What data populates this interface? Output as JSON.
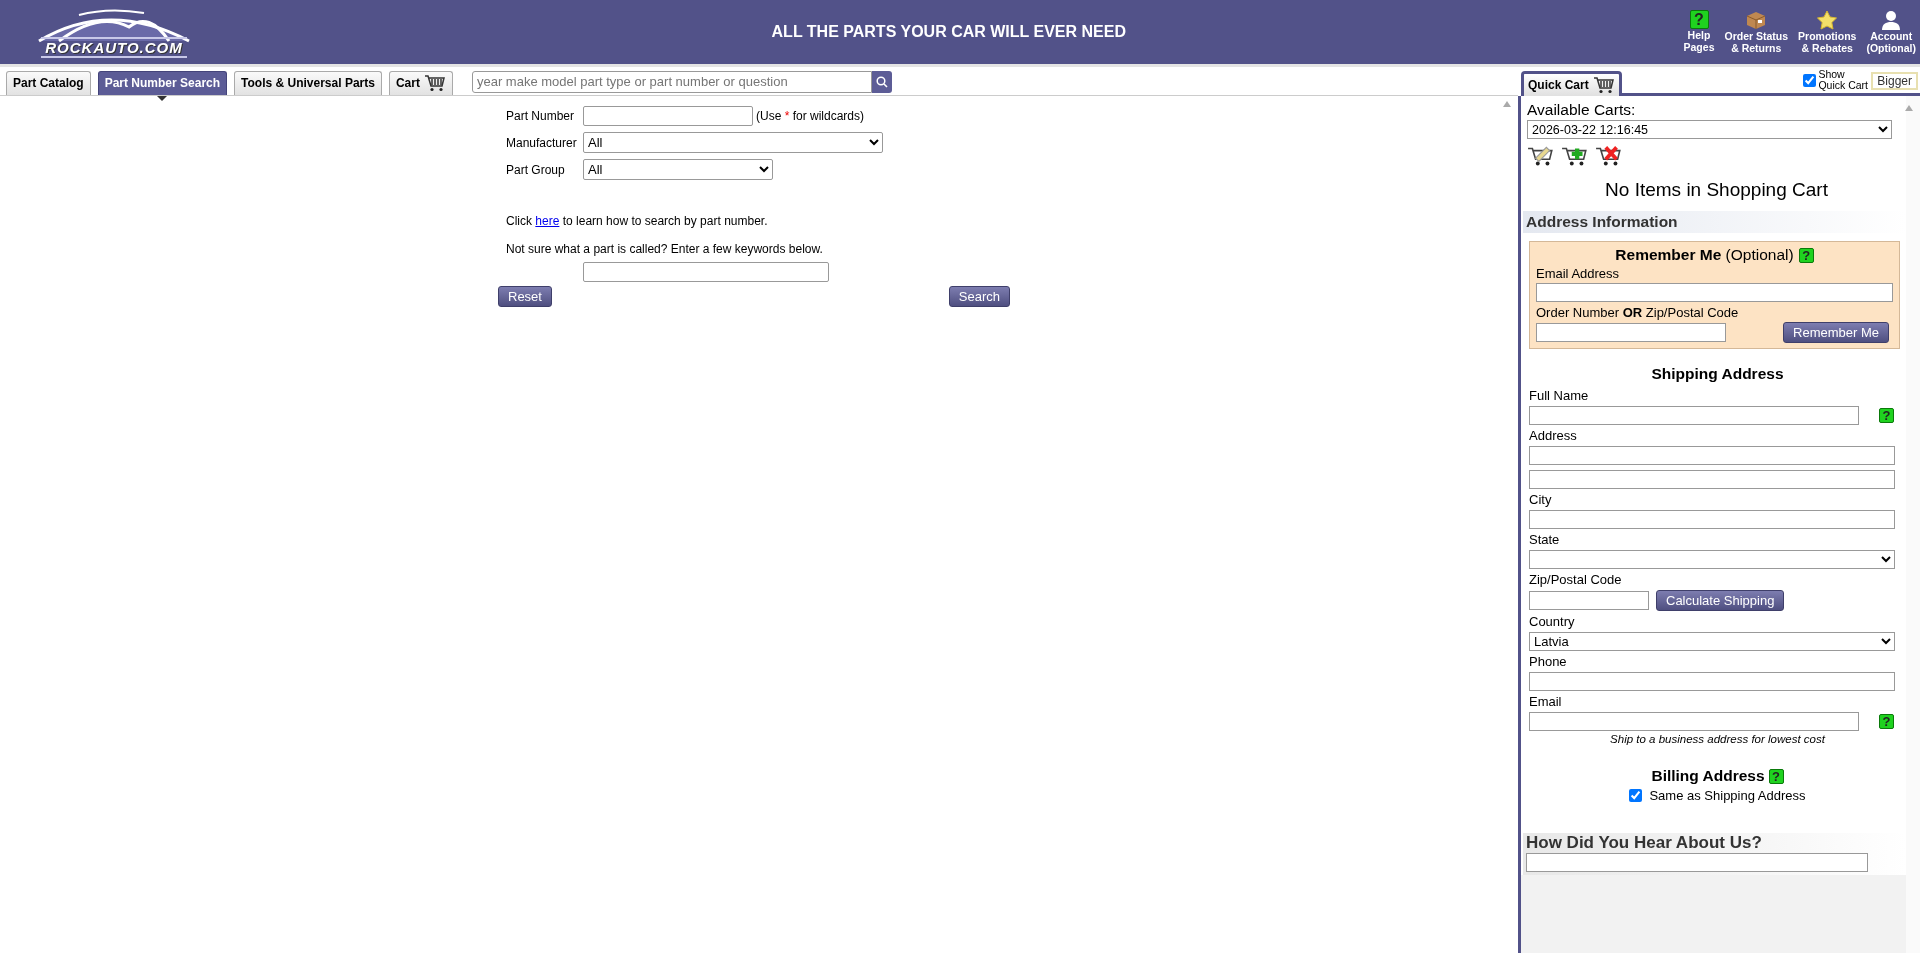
{
  "header": {
    "logo_text": "ROCKAUTO.COM",
    "tagline": "ALL THE PARTS YOUR CAR WILL EVER NEED",
    "links": [
      {
        "kind": "help",
        "mark": "?",
        "lines": [
          "Help",
          "Pages"
        ]
      },
      {
        "kind": "box",
        "lines": [
          "Order Status",
          "& Returns"
        ]
      },
      {
        "kind": "star",
        "lines": [
          "Promotions",
          "& Rebates"
        ]
      },
      {
        "kind": "person",
        "lines": [
          "Account",
          "(Optional)"
        ]
      }
    ]
  },
  "tabs": [
    {
      "label": "Part Catalog",
      "kind": "text",
      "selected": false
    },
    {
      "label": "Part Number Search",
      "kind": "text",
      "selected": true
    },
    {
      "label": "Tools & Universal Parts",
      "kind": "text",
      "selected": false
    },
    {
      "label": "Cart",
      "kind": "cart",
      "selected": false
    }
  ],
  "search": {
    "placeholder": "year make model part type or part number or question"
  },
  "part_search": {
    "fields": [
      {
        "label": "Part Number",
        "kind": "text",
        "note_before": "(Use ",
        "note_mark": "*",
        "note_after": " for wildcards)"
      },
      {
        "label": "Manufacturer",
        "kind": "select",
        "value": "All"
      },
      {
        "label": "Part Group",
        "kind": "select",
        "value": "All"
      }
    ],
    "help_before": "Click ",
    "help_link": "here",
    "help_after": " to learn how to search by part number.",
    "keywords_prompt": "Not sure what a part is called? Enter a few keywords below.",
    "buttons": [
      {
        "label": "Reset"
      },
      {
        "label": "Search"
      }
    ]
  },
  "quick_cart": {
    "tab": "Quick Cart",
    "show": {
      "lines": [
        "Show",
        "Quick Cart"
      ],
      "checked": true
    },
    "bigger": "Bigger",
    "available_label": "Available Carts:",
    "cart_value": "2026-03-22 12:16:45",
    "empty_message": "No Items in Shopping Cart",
    "address_heading": "Address Information",
    "remember": {
      "title": "Remember Me",
      "optional": "(Optional)",
      "mark": "?",
      "fields": [
        {
          "label": "Email Address"
        },
        {
          "label": "Order Number **OR** Zip/Postal Code"
        }
      ],
      "button": "Remember Me"
    },
    "shipping": {
      "title": "Shipping Address",
      "fields": [
        {
          "label": "Full Name",
          "kind": "text",
          "mark": "?"
        },
        {
          "label": "Address",
          "kind": "double_text"
        },
        {
          "label": "City",
          "kind": "text"
        },
        {
          "label": "State",
          "kind": "select"
        },
        {
          "label": "Zip/Postal Code",
          "kind": "short_text",
          "button": "Calculate Shipping"
        },
        {
          "label": "Country",
          "kind": "select",
          "value": "Latvia"
        },
        {
          "label": "Phone",
          "kind": "text"
        },
        {
          "label": "Email",
          "kind": "text",
          "mark": "?"
        }
      ],
      "note": "Ship to a business address for lowest cost"
    },
    "billing": {
      "title": "Billing Address",
      "mark": "?",
      "same_label": "Same as Shipping Address",
      "checked": true
    },
    "hear_heading": "How Did You Hear About Us?"
  }
}
